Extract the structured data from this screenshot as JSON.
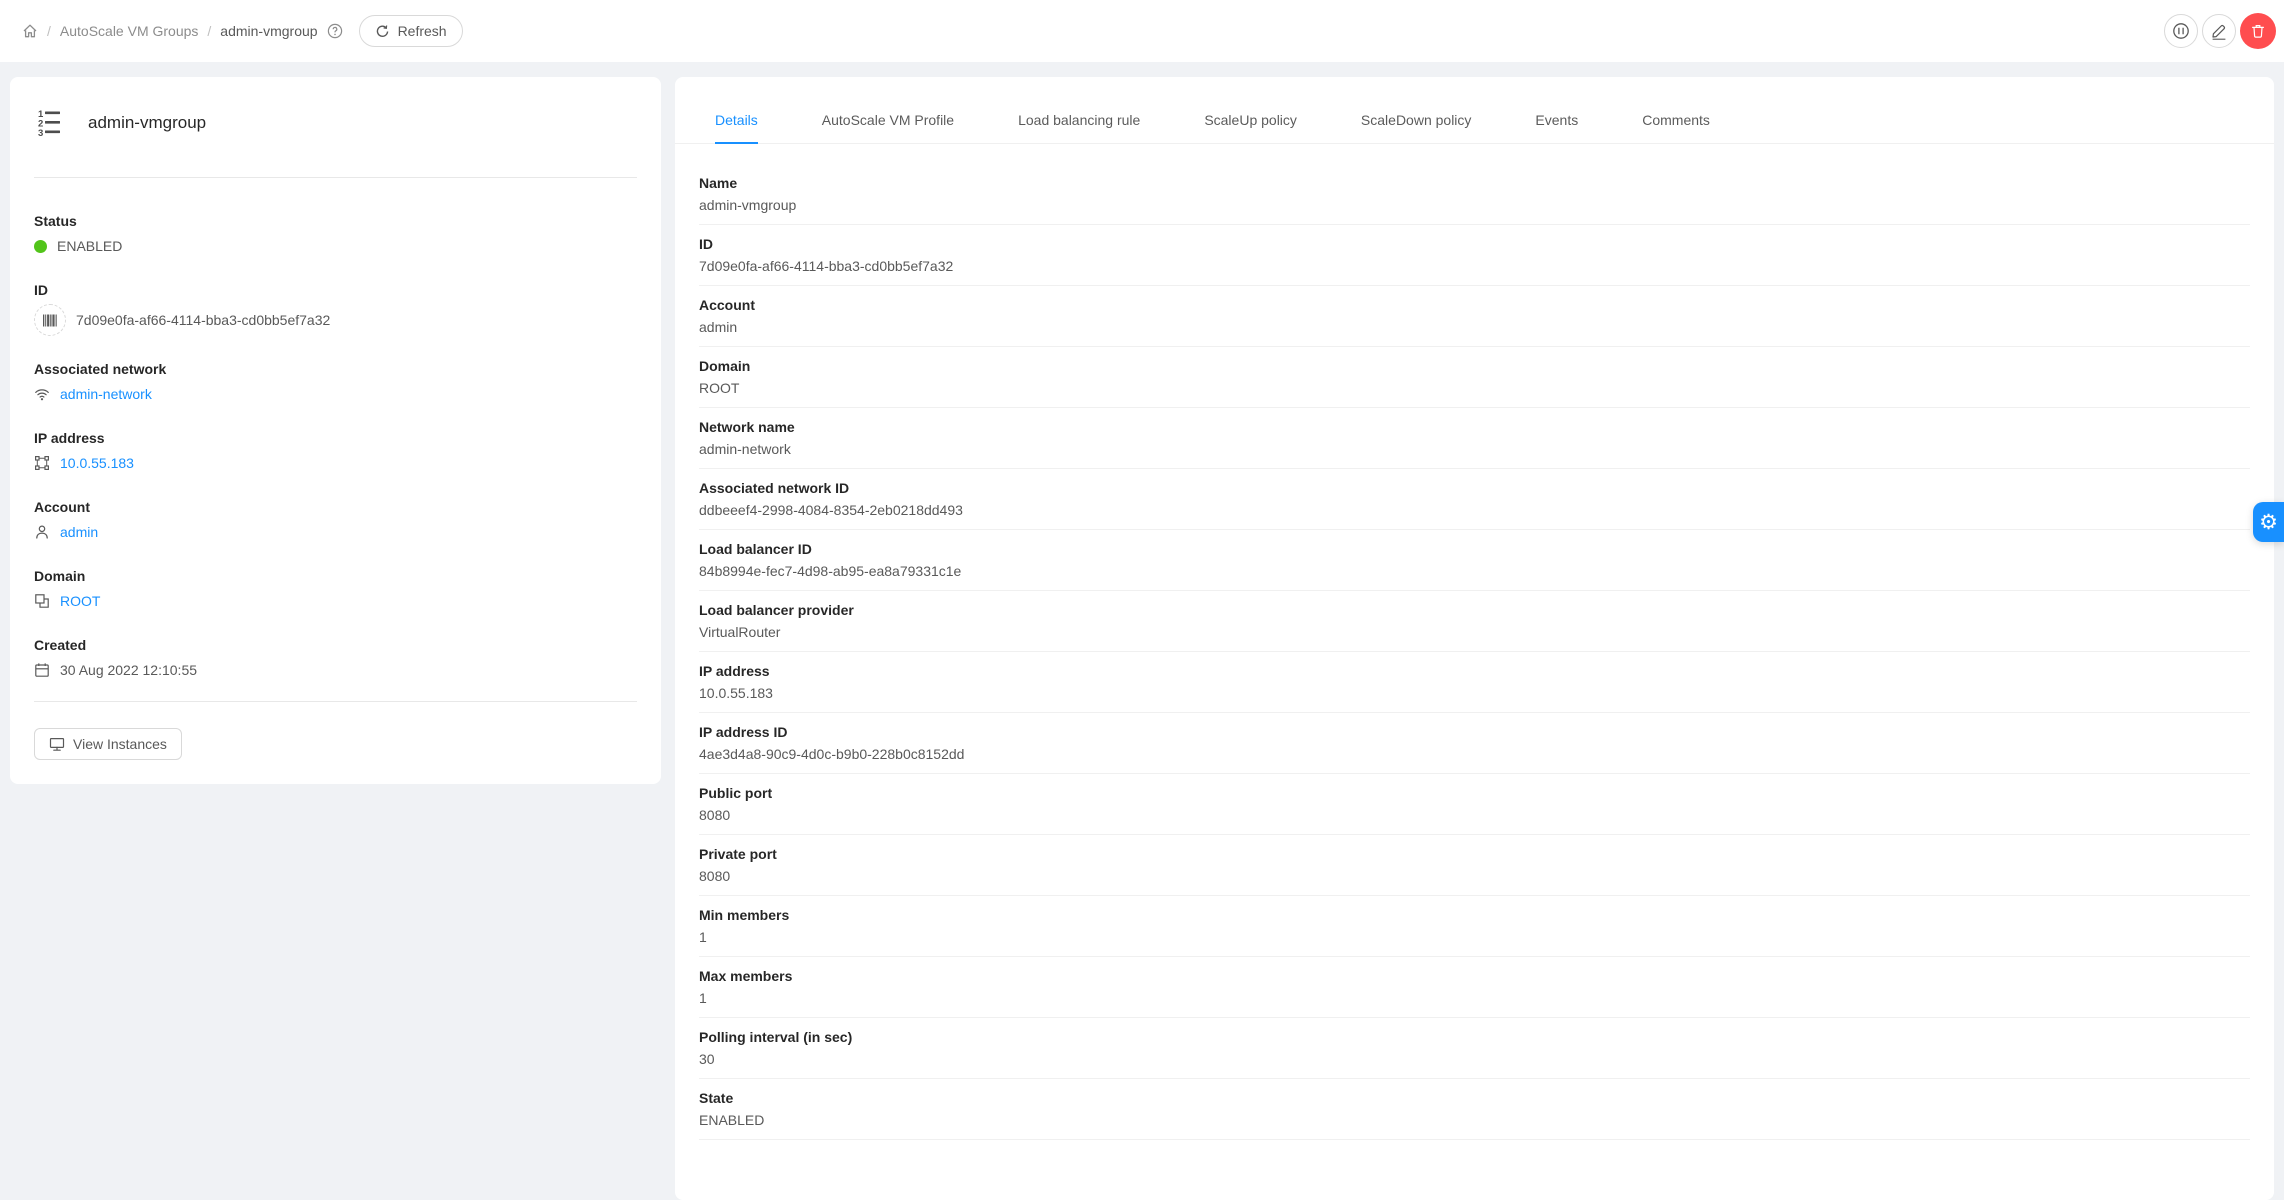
{
  "header": {
    "breadcrumb": {
      "home_icon": "home",
      "section": "AutoScale VM Groups",
      "current": "admin-vmgroup",
      "help_icon": "question-circle"
    },
    "refresh_button": "Refresh",
    "actions": [
      {
        "name": "pause",
        "icon": "pause-circle"
      },
      {
        "name": "edit",
        "icon": "edit-pencil"
      },
      {
        "name": "delete",
        "icon": "trash",
        "color": "#ff4d4f"
      }
    ]
  },
  "info_card": {
    "icon": "ordered-list",
    "title": "admin-vmgroup",
    "sections": [
      {
        "label": "Status",
        "value": "ENABLED",
        "icon": "status-dot",
        "link": false
      },
      {
        "label": "ID",
        "value": "7d09e0fa-af66-4114-bba3-cd0bb5ef7a32",
        "icon": "barcode",
        "link": false
      },
      {
        "label": "Associated network",
        "value": "admin-network",
        "icon": "wifi",
        "link": true
      },
      {
        "label": "IP address",
        "value": "10.0.55.183",
        "icon": "gateway",
        "link": true
      },
      {
        "label": "Account",
        "value": "admin",
        "icon": "user",
        "link": true
      },
      {
        "label": "Domain",
        "value": "ROOT",
        "icon": "block",
        "link": true
      },
      {
        "label": "Created",
        "value": "30 Aug 2022 12:10:55",
        "icon": "calendar",
        "link": false
      }
    ],
    "footer_button": {
      "label": "View Instances",
      "icon": "desktop"
    }
  },
  "detail_card": {
    "tabs": [
      "Details",
      "AutoScale VM Profile",
      "Load balancing rule",
      "ScaleUp policy",
      "ScaleDown policy",
      "Events",
      "Comments"
    ],
    "active_tab": "Details",
    "rows": [
      {
        "label": "Name",
        "value": "admin-vmgroup"
      },
      {
        "label": "ID",
        "value": "7d09e0fa-af66-4114-bba3-cd0bb5ef7a32"
      },
      {
        "label": "Account",
        "value": "admin"
      },
      {
        "label": "Domain",
        "value": "ROOT"
      },
      {
        "label": "Network name",
        "value": "admin-network"
      },
      {
        "label": "Associated network ID",
        "value": "ddbeeef4-2998-4084-8354-2eb0218dd493"
      },
      {
        "label": "Load balancer ID",
        "value": "84b8994e-fec7-4d98-ab95-ea8a79331c1e"
      },
      {
        "label": "Load balancer provider",
        "value": "VirtualRouter"
      },
      {
        "label": "IP address",
        "value": "10.0.55.183"
      },
      {
        "label": "IP address ID",
        "value": "4ae3d4a8-90c9-4d0c-b9b0-228b0c8152dd"
      },
      {
        "label": "Public port",
        "value": "8080"
      },
      {
        "label": "Private port",
        "value": "8080"
      },
      {
        "label": "Min members",
        "value": "1"
      },
      {
        "label": "Max members",
        "value": "1"
      },
      {
        "label": "Polling interval (in sec)",
        "value": "30"
      },
      {
        "label": "State",
        "value": "ENABLED"
      }
    ]
  },
  "float_button": {
    "icon": "gear",
    "color": "#1890ff"
  },
  "colors": {
    "link": "#1890ff",
    "status_enabled": "#52c41a",
    "danger": "#ff4d4f",
    "background": "#f0f2f5"
  }
}
